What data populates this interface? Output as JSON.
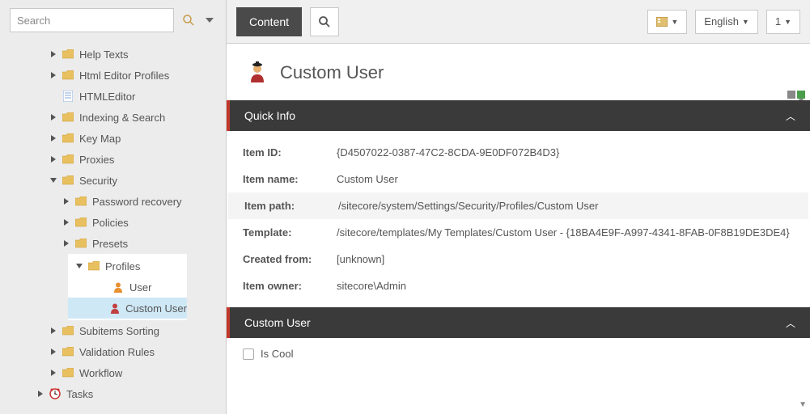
{
  "search": {
    "placeholder": "Search"
  },
  "ribbon": {
    "tab": "Content",
    "view_label": "",
    "language": "English",
    "version": "1"
  },
  "tree": {
    "items": [
      {
        "label": "Help Texts",
        "indent": 3,
        "icon": "folder",
        "expander": "right"
      },
      {
        "label": "Html Editor Profiles",
        "indent": 3,
        "icon": "folder",
        "expander": "right"
      },
      {
        "label": "HTMLEditor",
        "indent": 3,
        "icon": "doc",
        "expander": "none"
      },
      {
        "label": "Indexing & Search",
        "indent": 3,
        "icon": "folder",
        "expander": "right"
      },
      {
        "label": "Key Map",
        "indent": 3,
        "icon": "folder",
        "expander": "right"
      },
      {
        "label": "Proxies",
        "indent": 3,
        "icon": "folder",
        "expander": "right"
      },
      {
        "label": "Security",
        "indent": 3,
        "icon": "folder",
        "expander": "down"
      },
      {
        "label": "Password recovery",
        "indent": 4,
        "icon": "folder",
        "expander": "right"
      },
      {
        "label": "Policies",
        "indent": 4,
        "icon": "folder",
        "expander": "right"
      },
      {
        "label": "Presets",
        "indent": 4,
        "icon": "folder",
        "expander": "right"
      }
    ],
    "profiles": {
      "label": "Profiles",
      "children": [
        {
          "label": "User",
          "icon": "user-orange"
        },
        {
          "label": "Custom User",
          "icon": "user-red",
          "selected": true
        }
      ]
    },
    "after": [
      {
        "label": "Subitems Sorting",
        "indent": 3,
        "icon": "folder",
        "expander": "right"
      },
      {
        "label": "Validation Rules",
        "indent": 3,
        "icon": "folder",
        "expander": "right"
      },
      {
        "label": "Workflow",
        "indent": 3,
        "icon": "folder",
        "expander": "right"
      },
      {
        "label": "Tasks",
        "indent": 2,
        "icon": "clock",
        "expander": "right"
      }
    ]
  },
  "page": {
    "title": "Custom User",
    "sections": {
      "quickinfo": {
        "title": "Quick Info",
        "rows": [
          {
            "k": "Item ID:",
            "v": "{D4507022-0387-47C2-8CDA-9E0DF072B4D3}"
          },
          {
            "k": "Item name:",
            "v": "Custom User"
          },
          {
            "k": "Item path:",
            "v": "/sitecore/system/Settings/Security/Profiles/Custom User",
            "hl": true
          },
          {
            "k": "Template:",
            "v": "/sitecore/templates/My Templates/Custom User - {18BA4E9F-A997-4341-8FAB-0F8B19DE3DE4}"
          },
          {
            "k": "Created from:",
            "v": "[unknown]"
          },
          {
            "k": "Item owner:",
            "v": "sitecore\\Admin"
          }
        ]
      },
      "customuser": {
        "title": "Custom User",
        "field_label": "Is Cool"
      }
    }
  }
}
